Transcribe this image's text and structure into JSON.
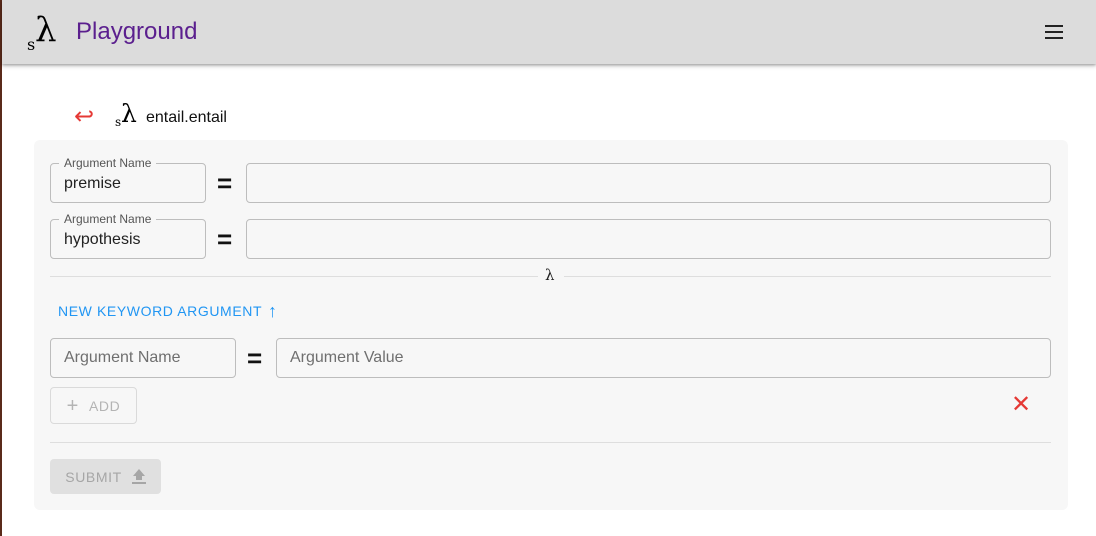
{
  "app": {
    "logo_sub": "s",
    "logo_lambda": "λ",
    "title": "Playground",
    "title_color": "#5b1f8e",
    "menu_icon": "menu-icon"
  },
  "breadcrumb": {
    "back_icon": "return-arrow-icon",
    "logo_sub": "s",
    "logo_lambda": "λ",
    "path": "entail.entail"
  },
  "arguments": [
    {
      "legend": "Argument Name",
      "name": "premise",
      "equals": "=",
      "value": ""
    },
    {
      "legend": "Argument Name",
      "name": "hypothesis",
      "equals": "=",
      "value": ""
    }
  ],
  "divider_symbol": "λ",
  "new_keyword": {
    "label": "NEW KEYWORD ARGUMENT",
    "icon": "arrow-upward-icon",
    "name_placeholder": "Argument Name",
    "equals": "=",
    "value_placeholder": "Argument Value",
    "add_label": "ADD",
    "add_icon": "plus-icon",
    "remove_icon": "close-icon"
  },
  "submit": {
    "label": "SUBMIT",
    "icon": "upload-icon"
  },
  "colors": {
    "accent": "#2196f3",
    "danger": "#e53935",
    "appbar": "#dcdcdc"
  }
}
